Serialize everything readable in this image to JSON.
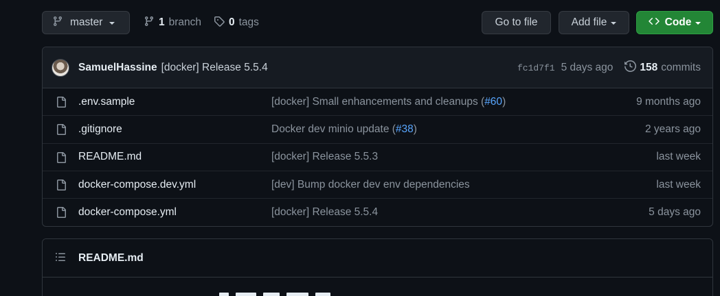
{
  "toolbar": {
    "branch_label": "master",
    "branches_count": "1",
    "branches_label": "branch",
    "tags_count": "0",
    "tags_label": "tags",
    "goto_label": "Go to file",
    "add_file_label": "Add file",
    "code_label": "Code"
  },
  "latest_commit": {
    "author": "SamuelHassine",
    "message": "[docker] Release 5.5.4",
    "sha": "fc1d7f1",
    "age": "5 days ago",
    "commits_count": "158",
    "commits_label": "commits"
  },
  "files": [
    {
      "name": ".env.sample",
      "msg_prefix": "[docker] Small enhancements and cleanups (",
      "msg_link": "#60",
      "msg_suffix": ")",
      "date": "9 months ago"
    },
    {
      "name": ".gitignore",
      "msg_prefix": "Docker dev minio update (",
      "msg_link": "#38",
      "msg_suffix": ")",
      "date": "2 years ago"
    },
    {
      "name": "README.md",
      "msg_prefix": "[docker] Release 5.5.3",
      "msg_link": "",
      "msg_suffix": "",
      "date": "last week"
    },
    {
      "name": "docker-compose.dev.yml",
      "msg_prefix": "[dev] Bump docker dev env dependencies",
      "msg_link": "",
      "msg_suffix": "",
      "date": "last week"
    },
    {
      "name": "docker-compose.yml",
      "msg_prefix": "[docker] Release 5.5.4",
      "msg_link": "",
      "msg_suffix": "",
      "date": "5 days ago"
    }
  ],
  "readme": {
    "title": "README.md"
  },
  "icons": {
    "branch": "git-branch-icon",
    "tag": "tag-icon",
    "code": "code-icon",
    "history": "history-icon",
    "file": "file-icon",
    "list": "list-unordered-icon"
  },
  "colors": {
    "background": "#0d1117",
    "code_button": "#238636",
    "link": "#58a6ff"
  }
}
